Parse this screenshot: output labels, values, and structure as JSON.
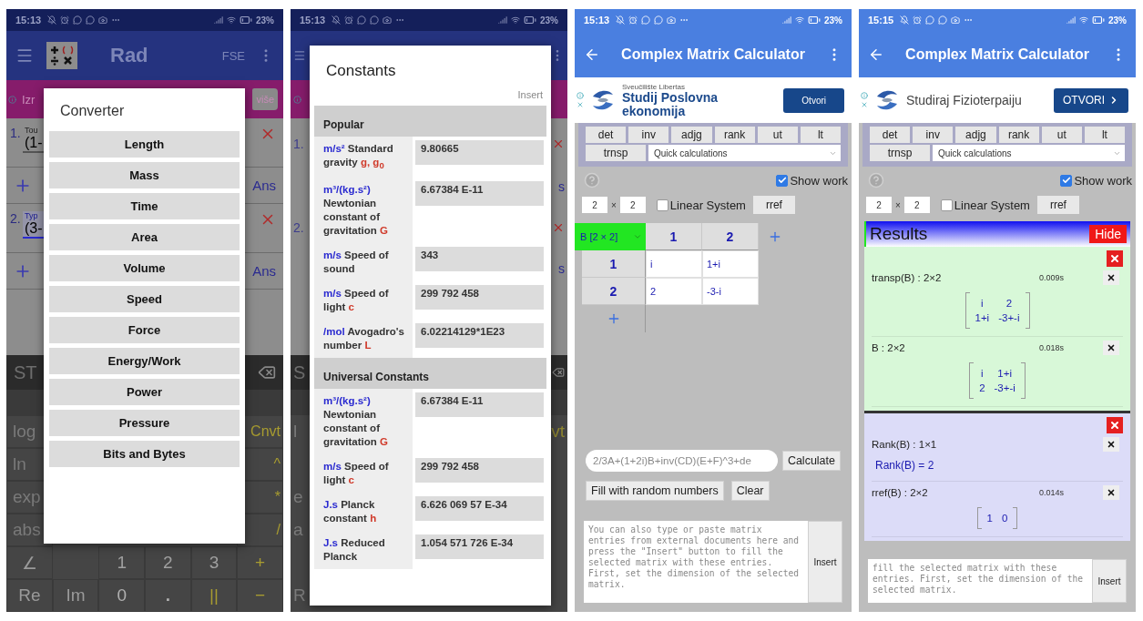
{
  "converter_screen": {
    "status": {
      "time": "15:13",
      "battery": "23%"
    },
    "app_bar": {
      "mode": "Rad",
      "format": "FSE"
    },
    "ad": {
      "text": "Izr",
      "button": "više"
    },
    "entries": [
      {
        "index": "1.",
        "hint": "Tou",
        "value": "(1-",
        "answer": "Ans",
        "focused": false
      },
      {
        "index": "2.",
        "hint": "Typ",
        "value": "(3-",
        "answer": "Ans",
        "focused": true
      }
    ],
    "keypad": {
      "store": "ST",
      "left_keys": [
        "log",
        "ln",
        "exp",
        "abs"
      ],
      "right_keys": [
        "Cnvt",
        "^",
        "*",
        "/"
      ],
      "row_5": [
        "∠",
        "1",
        "2",
        "3",
        "+"
      ],
      "row_6": [
        "Re",
        "Im",
        "0",
        ".",
        "||",
        "−"
      ]
    },
    "dialog": {
      "title": "Converter",
      "options": [
        "Length",
        "Mass",
        "Time",
        "Area",
        "Volume",
        "Speed",
        "Force",
        "Energy/Work",
        "Power",
        "Pressure",
        "Bits and Bytes"
      ]
    }
  },
  "constants_screen": {
    "status": {
      "time": "15:13",
      "battery": "23%"
    },
    "edges": {
      "entry_indexes": [
        "1.",
        "2."
      ],
      "answer_tails": [
        "s",
        "s"
      ],
      "key_heads": [
        "S",
        "l",
        "e",
        "a",
        "R"
      ],
      "key_tail": "vt"
    },
    "dialog": {
      "title": "Constants",
      "insert": "Insert",
      "sections": [
        {
          "title": "Popular",
          "constants": [
            {
              "unit": "m/s²",
              "name": "Standard gravity",
              "symbol": "g, g$_{0}$",
              "value": "9.80665"
            },
            {
              "unit": "m³/(kg.s²)",
              "name": "Newtonian constant of gravitation",
              "symbol": "G",
              "value": "6.67384 E-11"
            },
            {
              "unit": "m/s",
              "name": "Speed of sound",
              "value": "343"
            },
            {
              "unit": "m/s",
              "name": "Speed of light",
              "symbol": "c",
              "value": "299 792 458"
            },
            {
              "unit": "/mol",
              "name": "Avogadro's number",
              "symbol": "L",
              "value": "6.02214129*1E23"
            }
          ]
        },
        {
          "title": "Universal Constants",
          "constants": [
            {
              "unit": "m³/(kg.s²)",
              "name": "Newtonian constant of gravitation",
              "symbol": "G",
              "value": "6.67384 E-11"
            },
            {
              "unit": "m/s",
              "name": "Speed of light",
              "symbol": "c",
              "value": "299 792 458"
            },
            {
              "unit": "J.s",
              "name": "Planck constant",
              "symbol": "h",
              "value": "6.626 069 57 E-34"
            },
            {
              "unit": "J.s",
              "name": "Reduced Planck",
              "value": "1.054 571 726 E-34"
            }
          ]
        }
      ]
    }
  },
  "matrix_input_screen": {
    "status": {
      "time": "15:13",
      "battery": "23%"
    },
    "title": "Complex Matrix Calculator",
    "ad": {
      "kind": "two_line",
      "sponsor": "Sveučilište Libertas",
      "headline": "Studij Poslovna ekonomija",
      "button": "Otvori"
    },
    "tools": [
      "det",
      "inv",
      "adjg",
      "rank",
      "ut",
      "lt"
    ],
    "tool_extra": "trnsp",
    "quick_select": "Quick calculations",
    "show_work": {
      "label": "Show work",
      "checked": true
    },
    "rows": "2",
    "times": "×",
    "cols": "2",
    "linear_system": {
      "label": "Linear System",
      "checked": false
    },
    "rref": "rref",
    "matrix": {
      "tab": "B [2 × 2]",
      "col_headers": [
        "1",
        "2"
      ],
      "rows": [
        {
          "header": "1",
          "cells": [
            "i",
            "1+i"
          ]
        },
        {
          "header": "2",
          "cells": [
            "2",
            "-3-i"
          ]
        }
      ]
    },
    "expression_placeholder": "2/3A+(1+2i)B+inv(CD)(E+F)^3+de",
    "calculate": "Calculate",
    "fill_random": "Fill with random numbers",
    "clear": "Clear",
    "paste_placeholder": "You can also type or paste matrix entries from external documents here and press the \"Insert\" button to fill the selected matrix with these entries. First, set the dimension of the selected matrix.",
    "insert": "Insert"
  },
  "matrix_results_screen": {
    "status": {
      "time": "15:15",
      "battery": "23%"
    },
    "title": "Complex Matrix Calculator",
    "ad": {
      "kind": "single_line",
      "headline": "Studiraj Fizioterpaiju",
      "button": "OTVORI"
    },
    "tools": [
      "det",
      "inv",
      "adjg",
      "rank",
      "ut",
      "lt"
    ],
    "tool_extra": "trnsp",
    "quick_select": "Quick calculations",
    "show_work": {
      "label": "Show work",
      "checked": true
    },
    "rows": "2",
    "times": "×",
    "cols": "2",
    "linear_system": {
      "label": "Linear System",
      "checked": false
    },
    "rref": "rref",
    "results": {
      "title": "Results",
      "hide": "Hide",
      "groups": [
        {
          "color": "#d8f8d8",
          "items": [
            {
              "kind": "matrix",
              "label": "transp(B) : 2×2",
              "time": "0.009s",
              "matrix": [
                [
                  "i",
                  "2"
                ],
                [
                  "1+i",
                  "-3+-i"
                ]
              ]
            },
            {
              "kind": "matrix",
              "label": "B : 2×2",
              "time": "0.018s",
              "matrix": [
                [
                  "i",
                  "1+i"
                ],
                [
                  "2",
                  "-3+-i"
                ]
              ]
            }
          ]
        },
        {
          "color": "#dcdcf8",
          "items": [
            {
              "kind": "scalar",
              "label": "Rank(B) : 1×1",
              "value": "Rank(B) = 2"
            },
            {
              "kind": "matrix",
              "label": "rref(B) : 2×2",
              "time": "0.014s",
              "matrix": [
                [
                  "1",
                  "0"
                ]
              ]
            }
          ]
        }
      ]
    },
    "paste_placeholder": "fill the selected matrix with these entries. First, set the dimension of the selected matrix.",
    "insert": "Insert"
  }
}
